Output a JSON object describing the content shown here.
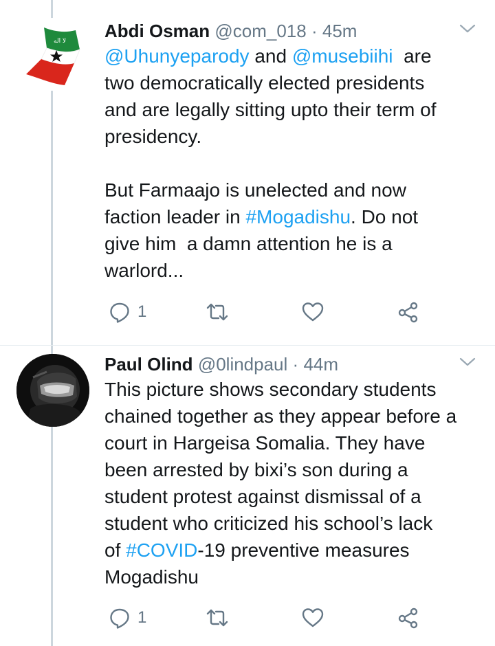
{
  "tweets": [
    {
      "name": "Abdi Osman",
      "handle": "@com_018",
      "separator": "·",
      "time": "45m",
      "avatar_icon": "somaliland-flag",
      "lines": [
        [
          {
            "t": "@Uhunyeparody",
            "link": true
          },
          {
            "t": " and "
          },
          {
            "t": "@musebiihi",
            "link": true
          },
          {
            "t": "  are"
          }
        ],
        [
          {
            "t": "two democratically elected presidents"
          }
        ],
        [
          {
            "t": "and are legally sitting upto their term of"
          }
        ],
        [
          {
            "t": "presidency."
          }
        ],
        [
          {
            "t": ""
          }
        ],
        [
          {
            "t": "But Farmaajo is unelected and now"
          }
        ],
        [
          {
            "t": "faction leader in "
          },
          {
            "t": "#Mogadishu",
            "link": true
          },
          {
            "t": ". Do not"
          }
        ],
        [
          {
            "t": "give him  a damn attention he is a"
          }
        ],
        [
          {
            "t": "warlord..."
          }
        ]
      ],
      "reply_count": "1"
    },
    {
      "name": "Paul Olind",
      "handle": "@0lindpaul",
      "separator": "·",
      "time": "44m",
      "avatar_icon": "helmet-rider-avatar",
      "lines": [
        [
          {
            "t": "This picture shows secondary students"
          }
        ],
        [
          {
            "t": "chained together as they appear before a"
          }
        ],
        [
          {
            "t": "court in Hargeisa Somalia. They have"
          }
        ],
        [
          {
            "t": "been arrested by bixi’s son during a"
          }
        ],
        [
          {
            "t": "student protest against dismissal of a"
          }
        ],
        [
          {
            "t": "student who criticized his school’s lack"
          }
        ],
        [
          {
            "t": "of "
          },
          {
            "t": "#COVID",
            "link": true
          },
          {
            "t": "-19 preventive measures"
          }
        ],
        [
          {
            "t": "Mogadishu"
          }
        ]
      ],
      "reply_count": "1"
    }
  ],
  "colors": {
    "link": "#1da1f2",
    "secondary_text": "#657786",
    "thread_line": "#ccd6dd"
  },
  "icons": [
    "reply-icon",
    "retweet-icon",
    "like-icon",
    "share-icon",
    "chevron-down-icon"
  ]
}
